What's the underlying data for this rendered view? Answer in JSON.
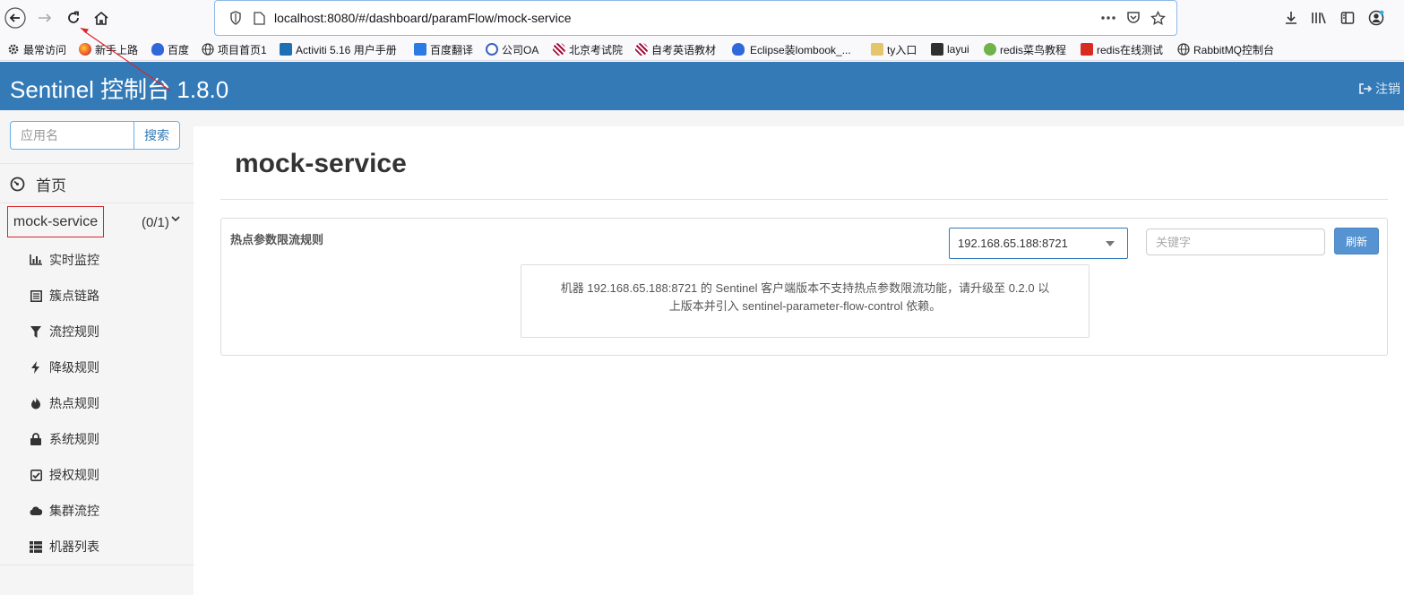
{
  "browser": {
    "url": "localhost:8080/#/dashboard/paramFlow/mock-service",
    "bookmarks": [
      {
        "label": "最常访问",
        "icon": "gear-icon"
      },
      {
        "label": "新手上路",
        "icon": "firefox-icon"
      },
      {
        "label": "百度",
        "icon": "baidu-icon"
      },
      {
        "label": "项目首页1",
        "icon": "globe-icon"
      },
      {
        "label": "Activiti 5.16 用户手册",
        "icon": "activiti-icon"
      },
      {
        "label": "百度翻译",
        "icon": "translate-icon"
      },
      {
        "label": "公司OA",
        "icon": "oa-icon"
      },
      {
        "label": "北京考试院",
        "icon": "exam-icon"
      },
      {
        "label": "自考英语教材",
        "icon": "exam-icon"
      },
      {
        "label": "Eclipse装lombook_...",
        "icon": "baidu-icon"
      },
      {
        "label": "ty入口",
        "icon": "ty-icon"
      },
      {
        "label": "layui",
        "icon": "layui-icon"
      },
      {
        "label": "redis菜鸟教程",
        "icon": "runoob-icon"
      },
      {
        "label": "redis在线测试",
        "icon": "redis-icon"
      },
      {
        "label": "RabbitMQ控制台",
        "icon": "globe-icon"
      }
    ]
  },
  "header": {
    "title": "Sentinel 控制台 1.8.0",
    "logout_label": "注销"
  },
  "sidebar": {
    "search_placeholder": "应用名",
    "search_button": "搜索",
    "home_label": "首页",
    "app_name": "mock-service",
    "app_count": "(0/1)",
    "menu": [
      {
        "label": "实时监控",
        "icon": "bar-chart-icon"
      },
      {
        "label": "簇点链路",
        "icon": "list-icon"
      },
      {
        "label": "流控规则",
        "icon": "filter-icon"
      },
      {
        "label": "降级规则",
        "icon": "flash-icon"
      },
      {
        "label": "热点规则",
        "icon": "fire-icon"
      },
      {
        "label": "系统规则",
        "icon": "lock-icon"
      },
      {
        "label": "授权规则",
        "icon": "check-square-icon"
      },
      {
        "label": "集群流控",
        "icon": "cloud-icon"
      },
      {
        "label": "机器列表",
        "icon": "th-list-icon"
      }
    ]
  },
  "main": {
    "title": "mock-service",
    "panel_title": "热点参数限流规则",
    "machine_selected": "192.168.65.188:8721",
    "keyword_placeholder": "关键字",
    "refresh_button": "刷新",
    "notice_line1": "机器 192.168.65.188:8721 的 Sentinel 客户端版本不支持热点参数限流功能，请升级至 0.2.0 以",
    "notice_line2": "上版本并引入 sentinel-parameter-flow-control 依赖。"
  },
  "colors": {
    "header_bg": "#337ab7",
    "annotation_red": "#d9262c",
    "refresh_bg": "#5593d2"
  }
}
